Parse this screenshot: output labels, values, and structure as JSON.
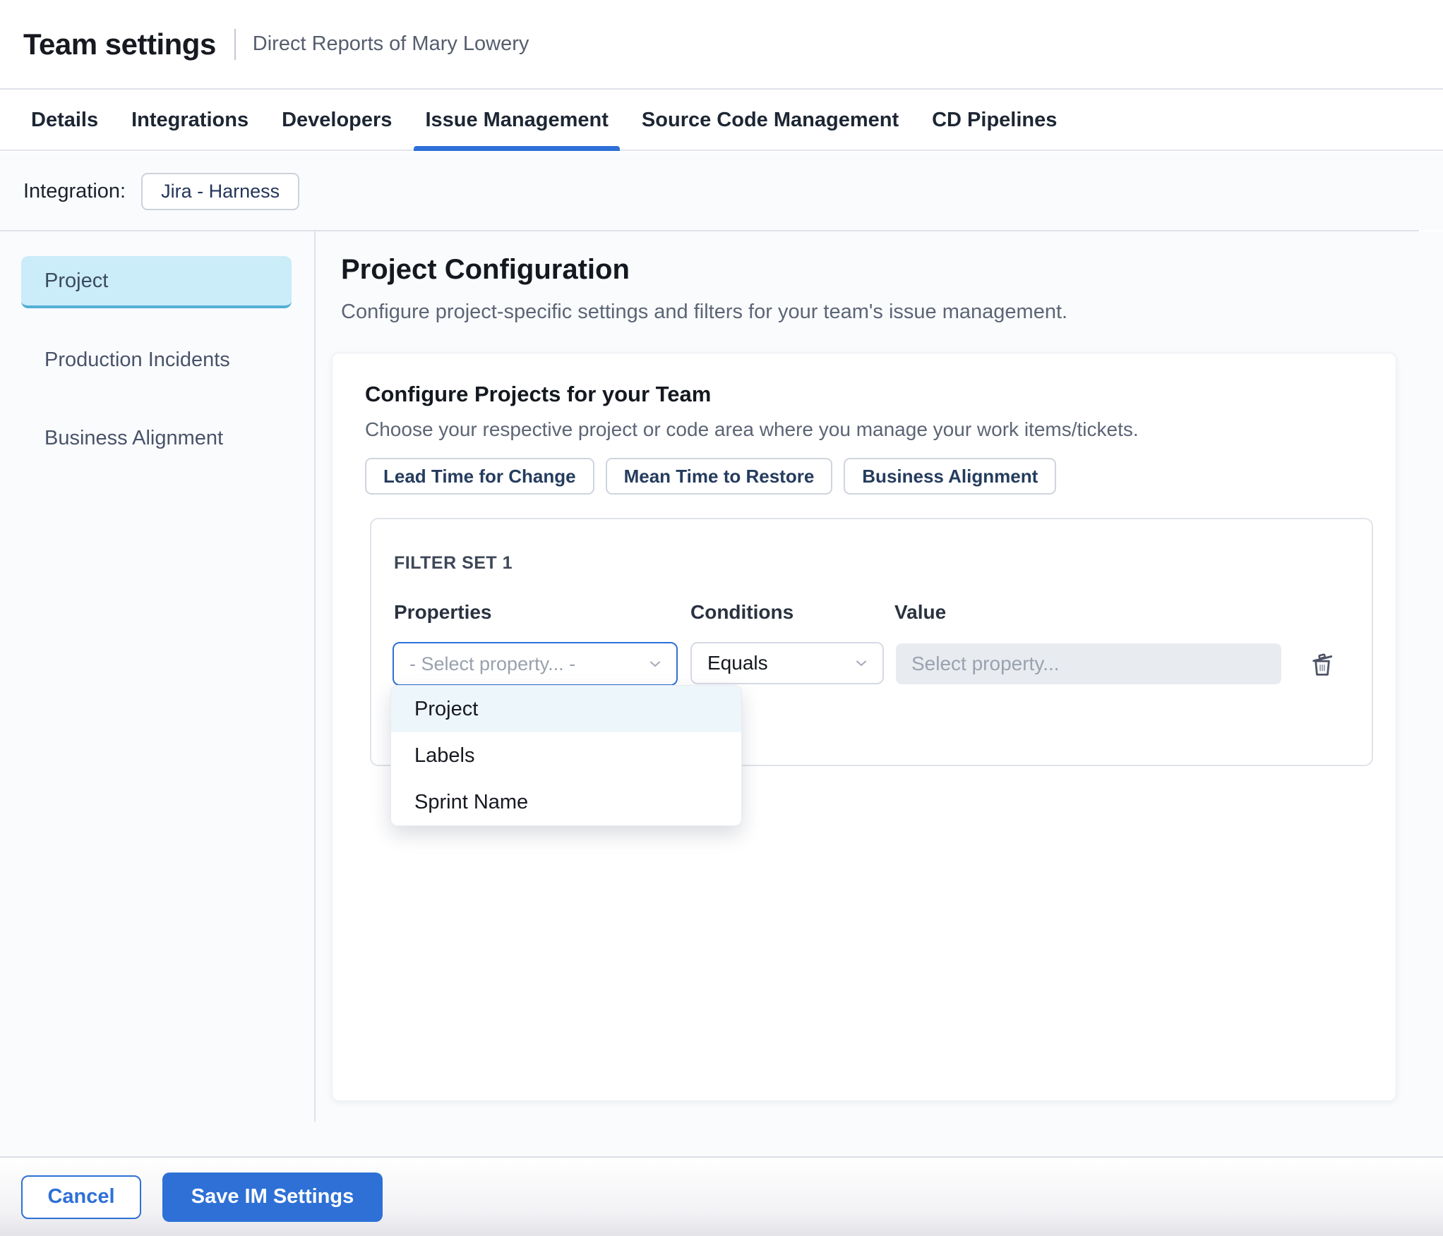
{
  "header": {
    "title": "Team settings",
    "subtitle": "Direct Reports of Mary Lowery"
  },
  "tabs": {
    "items": [
      {
        "label": "Details",
        "active": false
      },
      {
        "label": "Integrations",
        "active": false
      },
      {
        "label": "Developers",
        "active": false
      },
      {
        "label": "Issue Management",
        "active": true
      },
      {
        "label": "Source Code Management",
        "active": false
      },
      {
        "label": "CD Pipelines",
        "active": false
      }
    ]
  },
  "integration": {
    "label": "Integration:",
    "badge": "Jira - Harness"
  },
  "sidebar": {
    "items": [
      {
        "label": "Project",
        "selected": true
      },
      {
        "label": "Production Incidents",
        "selected": false
      },
      {
        "label": "Business Alignment",
        "selected": false
      }
    ]
  },
  "main": {
    "title": "Project Configuration",
    "subtitle": "Configure project-specific settings and filters for your team's issue management.",
    "card": {
      "title": "Configure Projects for your Team",
      "subtitle": "Choose your respective project or code area where you manage your work items/tickets.",
      "chips": [
        "Lead Time for Change",
        "Mean Time to Restore",
        "Business Alignment"
      ],
      "filter_set": {
        "title": "FILTER SET 1",
        "columns": {
          "properties": "Properties",
          "conditions": "Conditions",
          "value": "Value"
        },
        "property_placeholder": "- Select property... -",
        "condition_value": "Equals",
        "value_placeholder": "Select property...",
        "dropdown": {
          "options": [
            "Project",
            "Labels",
            "Sprint Name"
          ],
          "highlighted": "Project"
        }
      }
    }
  },
  "footer": {
    "cancel_label": "Cancel",
    "save_label": "Save IM Settings"
  },
  "icons": {
    "chevron_down": "chevron-down",
    "trash": "trash-can-open-lid"
  },
  "colors": {
    "accent_blue": "#2e70d6",
    "selected_sidebar_bg": "#cbecf9",
    "selected_sidebar_border": "#54afd4",
    "dropdown_highlight": "#edf6fb",
    "value_input_bg": "#e8ecf0",
    "content_bg": "#fafbfd",
    "chip_text": "#253c5e"
  }
}
